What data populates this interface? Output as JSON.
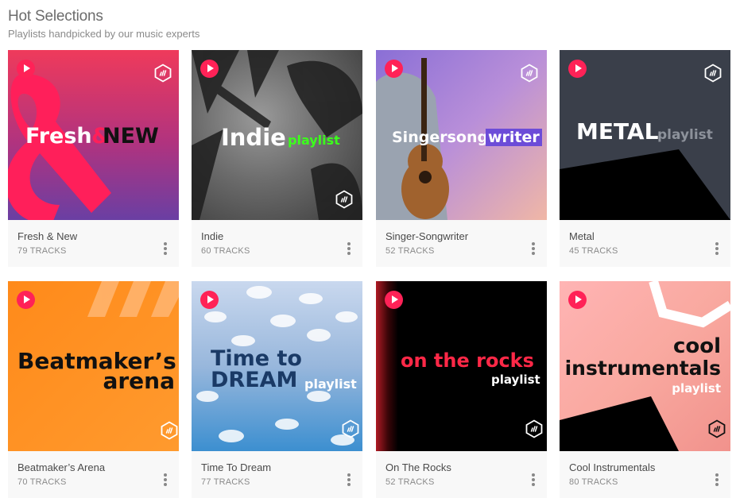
{
  "header": {
    "title": "Hot Selections",
    "subtitle": "Playlists handpicked by our music experts"
  },
  "colors": {
    "accent": "#ff2257",
    "card_bg": "#f8f8f8"
  },
  "icons": {
    "play": "play-icon",
    "badge": "hexagon-logo-icon",
    "more": "more-vertical-icon"
  },
  "playlists": [
    {
      "name": "Fresh & New",
      "tracks": "79 TRACKS",
      "art": {
        "line1": "Fresh",
        "amp": "&",
        "line2": "NEW"
      }
    },
    {
      "name": "Indie",
      "tracks": "60 TRACKS",
      "art": {
        "line1": "Indie",
        "tag": "playlist"
      }
    },
    {
      "name": "Singer-Songwriter",
      "tracks": "52 TRACKS",
      "art": {
        "line1": "Singersong",
        "tag": "writer"
      }
    },
    {
      "name": "Metal",
      "tracks": "45 TRACKS",
      "art": {
        "line1": "METAL",
        "tag": "playlist"
      }
    },
    {
      "name": "Beatmaker’s Arena",
      "tracks": "70 TRACKS",
      "art": {
        "line1": "Beatmaker’s",
        "line2": "arena"
      }
    },
    {
      "name": "Time To Dream",
      "tracks": "77 TRACKS",
      "art": {
        "line1": "Time to",
        "line2": "DREAM",
        "tag": "playlist"
      }
    },
    {
      "name": "On The Rocks",
      "tracks": "52 TRACKS",
      "art": {
        "line1": "on the rocks",
        "tag": "playlist"
      }
    },
    {
      "name": "Cool Instrumentals",
      "tracks": "80 TRACKS",
      "art": {
        "line1": "cool",
        "line2": "instrumentals",
        "tag": "playlist"
      }
    }
  ]
}
